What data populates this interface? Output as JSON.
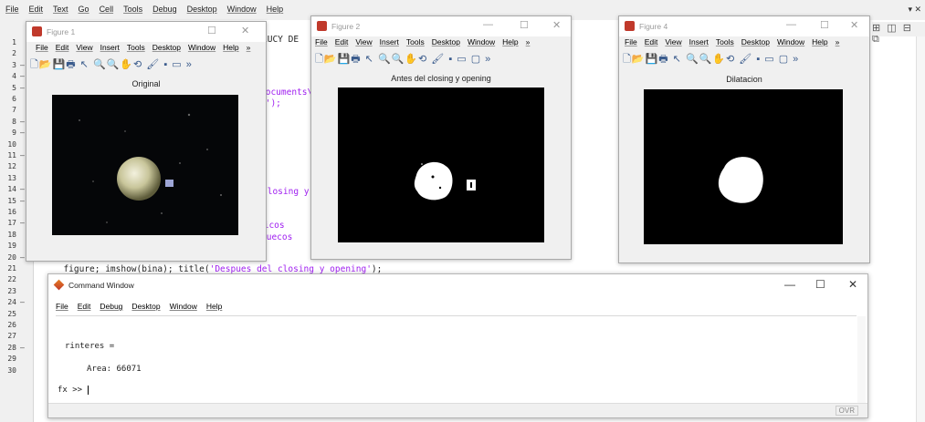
{
  "editor": {
    "menu": [
      "File",
      "Edit",
      "Text",
      "Go",
      "Cell",
      "Tools",
      "Debug",
      "Desktop",
      "Window",
      "Help"
    ],
    "right_controls": "▾ ✕",
    "right_toolbar": "⊞ ◫ ⊟ ⧉",
    "line_numbers": [
      "1",
      "2",
      "3",
      "4",
      "5",
      "6",
      "7",
      "8",
      "9",
      "10",
      "11",
      "12",
      "13",
      "14",
      "15",
      "16",
      "17",
      "18",
      "19",
      "20",
      "21",
      "22",
      "23",
      "24",
      "25",
      "26",
      "27",
      "28",
      "29",
      "30"
    ],
    "line_markers": [
      "",
      "",
      "–",
      "–",
      "–",
      "",
      "",
      "–",
      "–",
      "",
      "–",
      "",
      "",
      "–",
      "–",
      "",
      "–",
      "",
      "",
      "–",
      "",
      "",
      "",
      "–",
      "",
      "",
      "",
      "–",
      "",
      ""
    ],
    "code_fragments": {
      "line1": "LUCY DE",
      "line4": "Documents\\",
      "line5": "l');",
      "line11": "closing y",
      "line14": "picos",
      "line15": "huecos",
      "line17_a": "figure; imshow(bina); title(",
      "line17_b": "'Despues del closing y opening'",
      "line17_c": ");"
    }
  },
  "figures": [
    {
      "window_title": "Figure 1",
      "menu": [
        "File",
        "Edit",
        "View",
        "Insert",
        "Tools",
        "Desktop",
        "Window",
        "Help",
        "»"
      ],
      "toolbar": "🗋📂💾🖶 ↖ 🔍🔍✋⟲ 🖌 ▪ ▭ »",
      "axes_title": "Original"
    },
    {
      "window_title": "Figure 2",
      "menu": [
        "File",
        "Edit",
        "View",
        "Insert",
        "Tools",
        "Desktop",
        "Window",
        "Help",
        "»"
      ],
      "toolbar": "🗋📂💾🖶 ↖ 🔍🔍✋⟲ 🖌 ▪ ▭ ▢ »",
      "axes_title": "Antes del closing y opening"
    },
    {
      "window_title": "Figure 4",
      "menu": [
        "File",
        "Edit",
        "View",
        "Insert",
        "Tools",
        "Desktop",
        "Window",
        "Help",
        "»"
      ],
      "toolbar": "🗋📂💾🖶 ↖ 🔍🔍✋⟲ 🖌 ▪ ▭ ▢ »",
      "axes_title": "Dilatacion"
    }
  ],
  "window_buttons": {
    "minimize": "—",
    "maximize": "☐",
    "close": "✕"
  },
  "command_window": {
    "title": "Command Window",
    "menu": [
      "File",
      "Edit",
      "Debug",
      "Desktop",
      "Window",
      "Help"
    ],
    "output_var": "rinteres =",
    "output_value": "Area: 66071",
    "prompt": "fx >> ",
    "status": "OVR"
  },
  "colors": {
    "figure_bg": "#f0f0f0",
    "axes_bg": "#000000",
    "editor_purple": "#a020f0",
    "matlab_icon": "#c0392b"
  }
}
